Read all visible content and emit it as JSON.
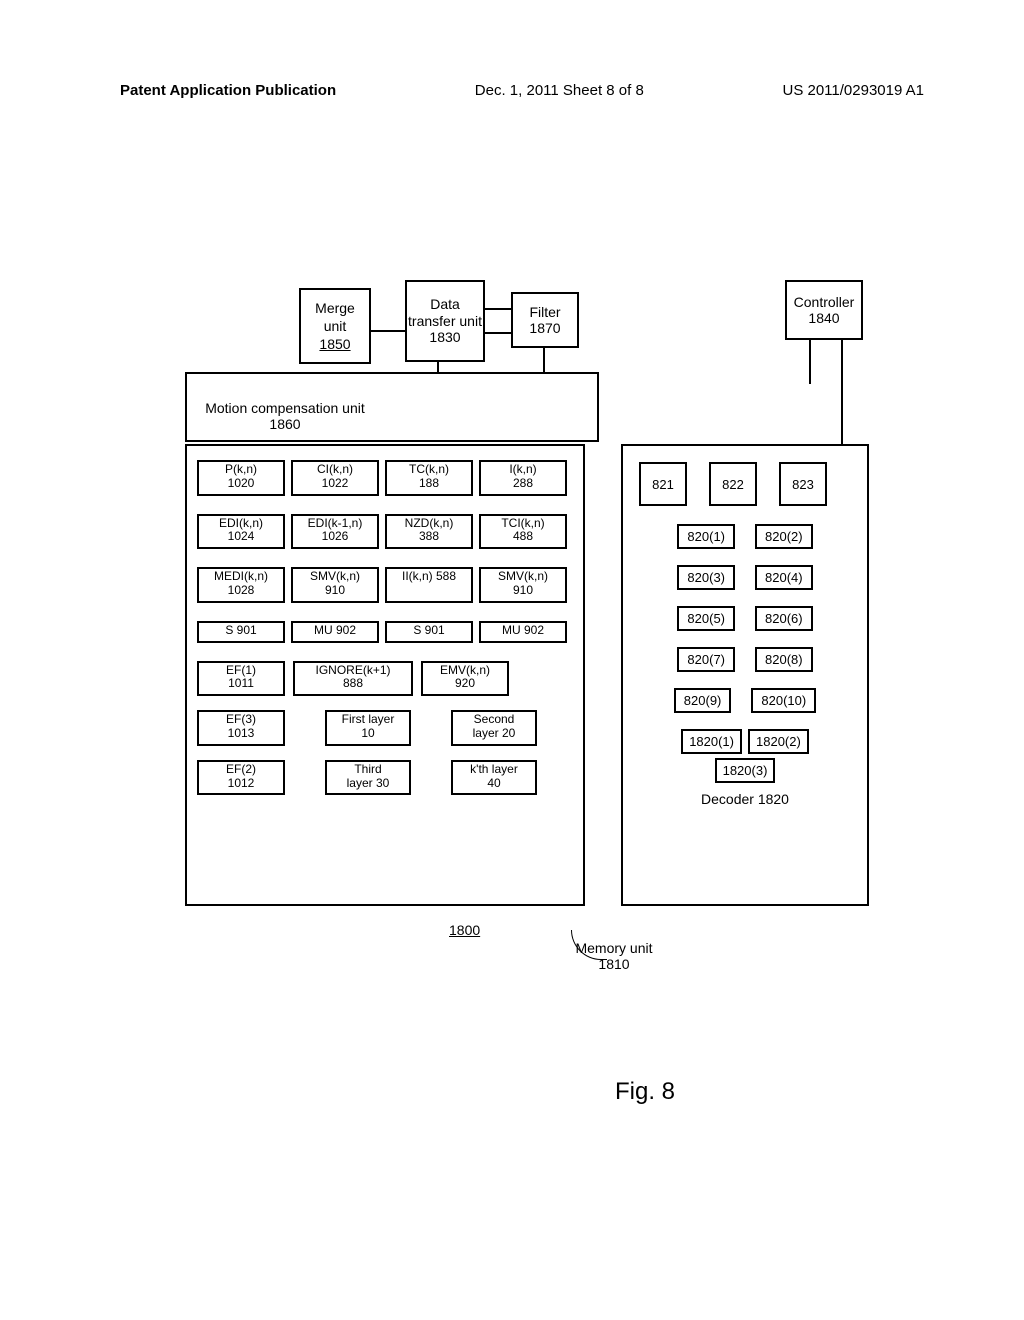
{
  "header": {
    "left": "Patent Application Publication",
    "mid": "Dec. 1, 2011  Sheet 8 of 8",
    "right": "US 2011/0293019 A1"
  },
  "top": {
    "merge": {
      "l1": "Merge",
      "l2": "unit",
      "l3": "1850"
    },
    "dtu": "Data transfer unit 1830",
    "filter": {
      "l1": "Filter",
      "l2": "1870"
    },
    "mcu": "Motion compensation unit 1860",
    "controller": {
      "l1": "Controller",
      "l2": "1840"
    }
  },
  "mem": {
    "r1": [
      {
        "t": "P(k,n)",
        "s": "1020"
      },
      {
        "t": "CI(k,n)",
        "s": "1022"
      },
      {
        "t": "TC(k,n)",
        "s": "188"
      },
      {
        "t": "I(k,n)",
        "s": "288"
      }
    ],
    "r2": [
      {
        "t": "EDI(k,n)",
        "s": "1024"
      },
      {
        "t": "EDI(k-1,n)",
        "s": "1026"
      },
      {
        "t": "NZD(k,n)",
        "s": "388"
      },
      {
        "t": "TCI(k,n)",
        "s": "488"
      }
    ],
    "r3": [
      {
        "t": "MEDI(k,n)",
        "s": "1028"
      },
      {
        "t": "SMV(k,n)",
        "s": "910"
      },
      {
        "t2": "II(k,n) 588"
      },
      {
        "t": "SMV(k,n)",
        "s": "910"
      }
    ],
    "r4": [
      {
        "t2": "S 901"
      },
      {
        "t2": "MU 902"
      },
      {
        "t2": "S 901"
      },
      {
        "t2": "MU 902"
      }
    ],
    "r5": [
      {
        "t": "EF(1)",
        "s": "1011"
      },
      {
        "t": "IGNORE(k+1)",
        "s": "888"
      },
      {
        "t": "EMV(k,n)",
        "s": "920"
      }
    ],
    "r6": [
      {
        "t": "EF(3)",
        "s": "1013"
      },
      {
        "l1": "First layer",
        "l2": "10"
      },
      {
        "l1": "Second",
        "l2": "layer 20"
      }
    ],
    "r7": [
      {
        "t": "EF(2)",
        "s": "1012"
      },
      {
        "l1": "Third",
        "l2": "layer 30"
      },
      {
        "l1": "k'th layer",
        "l2": "40"
      }
    ]
  },
  "dec": {
    "s": [
      "821",
      "822",
      "823"
    ],
    "p": [
      "820(1)",
      "820(2)",
      "820(3)",
      "820(4)",
      "820(5)",
      "820(6)",
      "820(7)",
      "820(8)",
      "820(9)",
      "820(10)"
    ],
    "q": [
      "1820(1)",
      "1820(2)",
      "1820(3)"
    ],
    "label": "Decoder 1820"
  },
  "below": {
    "num": "1800",
    "memunit": "Memory unit 1810"
  },
  "fig": "Fig. 8"
}
